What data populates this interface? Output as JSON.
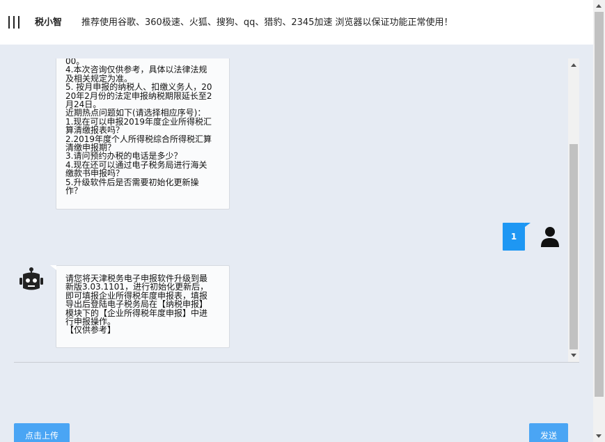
{
  "header": {
    "title": "税小智",
    "notice": "推荐使用谷歌、360极速、火狐、搜狗、qq、猎豹、2345加速 浏览器以保证功能正常使用！"
  },
  "messages": {
    "bot_hotlist": {
      "lines": [
        "00。",
        "4.本次咨询仅供参考，具体以法律法规",
        "及相关规定为准。",
        "5. 按月申报的纳税人、扣缴义务人，20",
        "20年2月份的法定申报纳税期限延长至2",
        "月24日。",
        "近期热点问题如下(请选择相应序号)：",
        "1.现在可以申报2019年度企业所得税汇",
        "算清缴报表吗？",
        "2.2019年度个人所得税综合所得税汇算",
        "清缴申报期？",
        "3.请问预约办税的电话是多少？",
        "4.现在还可以通过电子税务局进行海关",
        "缴款书申报吗？",
        "5.升级软件后是否需要初始化更新操",
        "作？"
      ]
    },
    "user_reply": "1",
    "bot_answer": {
      "lines": [
        "请您将天津税务电子申报软件升级到最",
        "新版3.03.1101，进行初始化更新后，",
        "即可填报企业所得税年度申报表，填报",
        "导出后登陆电子税务局在【纳税申报】",
        "模块下的【企业所得税年度申报】中进",
        "行申报操作。",
        "【仅供参考】"
      ]
    }
  },
  "actions": {
    "upload_label": "点击上传",
    "send_label": "发送"
  },
  "icons": {
    "menu": "menu-icon",
    "bot": "robot-icon",
    "user": "user-icon"
  },
  "colors": {
    "accent": "#1e97f3",
    "button": "#4aa5f4",
    "background": "#e6ebf3"
  }
}
